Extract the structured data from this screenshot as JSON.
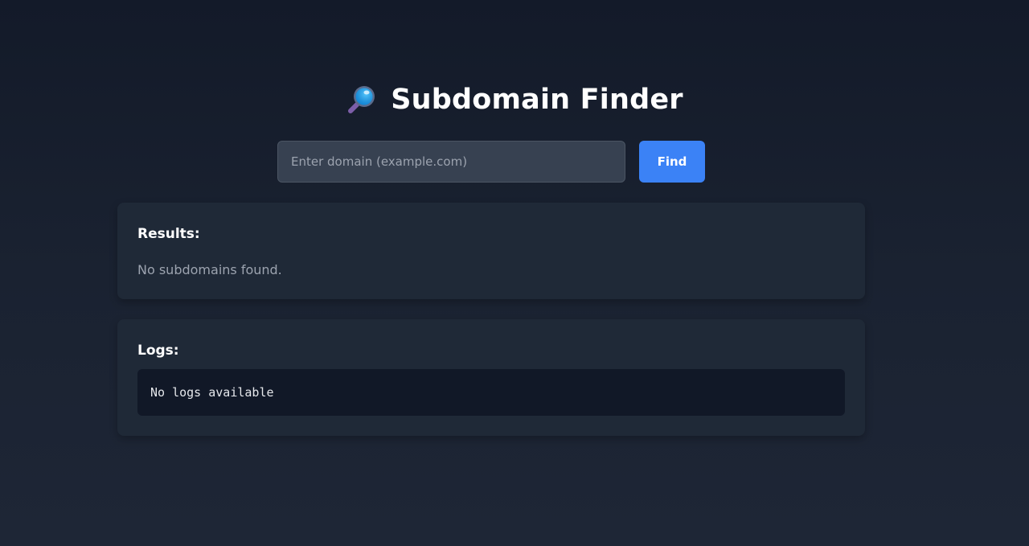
{
  "header": {
    "icon": "magnifier-icon",
    "title": "Subdomain Finder"
  },
  "search": {
    "value": "",
    "placeholder": "Enter domain (example.com)",
    "button_label": "Find"
  },
  "results": {
    "heading": "Results:",
    "empty_message": "No subdomains found."
  },
  "logs": {
    "heading": "Logs:",
    "content": "No logs available"
  },
  "colors": {
    "accent": "#3b82f6",
    "panel": "#1f2937",
    "log_bg": "#111827",
    "input_bg": "#374151"
  }
}
